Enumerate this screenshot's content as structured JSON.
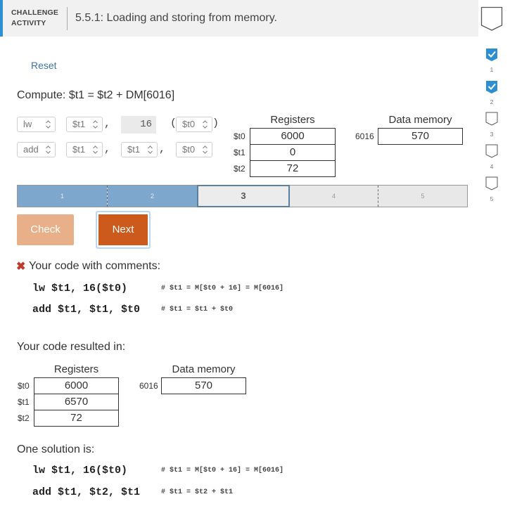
{
  "header": {
    "label_line1": "CHALLENGE",
    "label_line2": "ACTIVITY",
    "title": "5.5.1: Loading and storing from memory."
  },
  "progress": {
    "levels": [
      {
        "num": "1",
        "completed": true
      },
      {
        "num": "2",
        "completed": true
      },
      {
        "num": "3",
        "completed": false
      },
      {
        "num": "4",
        "completed": false
      },
      {
        "num": "5",
        "completed": false
      }
    ]
  },
  "reset_label": "Reset",
  "compute_text": "Compute: $t1 = $t2 + DM[6016]",
  "editor": {
    "line1": {
      "op": "lw",
      "rt": "$t1",
      "comma": ",",
      "imm": "16",
      "open": "(",
      "rs": "$t0",
      "close": ")"
    },
    "line2": {
      "op": "add",
      "rd": "$t1",
      "comma1": ",",
      "rs": "$t1",
      "comma2": ",",
      "rt": "$t0"
    }
  },
  "registers_title": "Registers",
  "memory_title": "Data memory",
  "registers": [
    {
      "name": "$t0",
      "value": "6000"
    },
    {
      "name": "$t1",
      "value": "0"
    },
    {
      "name": "$t2",
      "value": "72"
    }
  ],
  "memory": {
    "address": "6016",
    "value": "570"
  },
  "steps": [
    "1",
    "2",
    "3",
    "4",
    "5"
  ],
  "current_step": "3",
  "buttons": {
    "check": "Check",
    "next": "Next"
  },
  "feedback": {
    "x_mark": "✖",
    "title": "Your code with comments:",
    "lines": [
      {
        "code": "lw $t1, 16($t0)",
        "comment": "# $t1 = M[$t0 + 16] = M[6016]"
      },
      {
        "code": "add $t1, $t1, $t0",
        "comment": "# $t1 = $t1 + $t0"
      }
    ]
  },
  "result": {
    "title": "Your code resulted in:",
    "registers_title": "Registers",
    "memory_title": "Data memory",
    "registers": [
      {
        "name": "$t0",
        "value": "6000"
      },
      {
        "name": "$t1",
        "value": "6570"
      },
      {
        "name": "$t2",
        "value": "72"
      }
    ],
    "memory": {
      "address": "6016",
      "value": "570"
    }
  },
  "solution": {
    "title": "One solution is:",
    "lines": [
      {
        "code": "lw $t1, 16($t0)",
        "comment": "# $t1 = M[$t0 + 16] = M[6016]"
      },
      {
        "code": "add $t1, $t2, $t1",
        "comment": "# $t1 = $t2 + $t1"
      }
    ]
  },
  "colors": {
    "accent_blue": "#2b8fd1",
    "check_done": "#2b8fd1",
    "step_done": "#7da7cc",
    "next_button": "#cc5a1d",
    "check_button": "#e7b088",
    "error_red": "#c0392b",
    "link": "#3f74a8"
  }
}
